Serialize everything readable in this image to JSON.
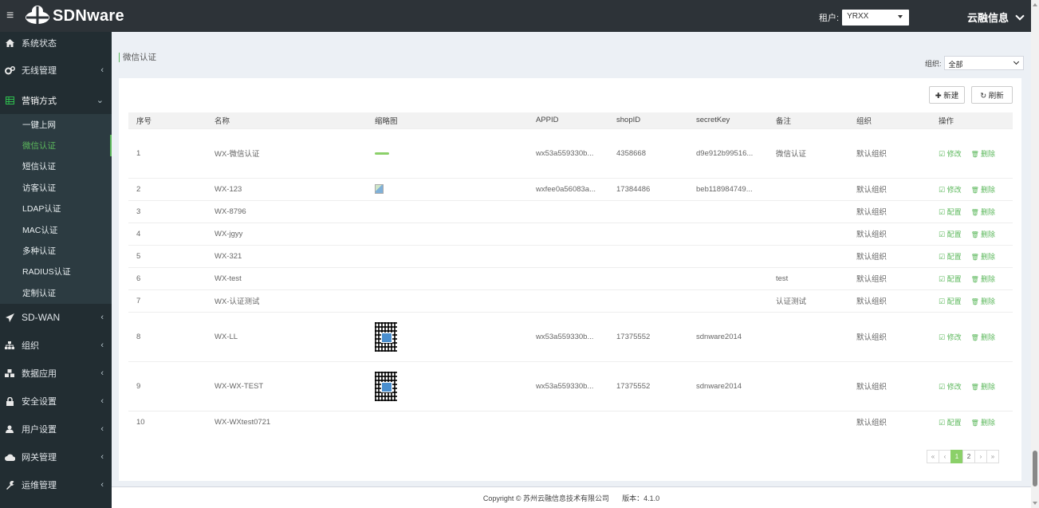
{
  "topbar": {
    "logo_text": "SDNware",
    "tenant_label": "租户:",
    "tenant_value": "YRXX",
    "brand": "云融信息"
  },
  "sidebar": {
    "items": [
      {
        "label": "系统状态",
        "icon": "home-icon"
      },
      {
        "label": "无线管理",
        "icon": "gears-icon"
      },
      {
        "label": "营销方式",
        "icon": "table-icon"
      }
    ],
    "sub_items": [
      "一键上网",
      "微信认证",
      "短信认证",
      "访客认证",
      "LDAP认证",
      "MAC认证",
      "多种认证",
      "RADIUS认证",
      "定制认证"
    ],
    "items_after": [
      {
        "label": "SD-WAN",
        "icon": "send-icon"
      },
      {
        "label": "组织",
        "icon": "sitemap-icon"
      },
      {
        "label": "数据应用",
        "icon": "cubes-icon"
      },
      {
        "label": "安全设置",
        "icon": "lock-icon"
      },
      {
        "label": "用户设置",
        "icon": "user-icon"
      },
      {
        "label": "网关管理",
        "icon": "cloud-icon"
      },
      {
        "label": "运维管理",
        "icon": "wrench-icon"
      }
    ]
  },
  "header": {
    "title": "微信认证",
    "org_label": "组织:",
    "org_value": "全部"
  },
  "toolbar": {
    "new_label": "✚ 新建",
    "refresh_label": "↻ 刷新"
  },
  "table": {
    "columns": [
      "序号",
      "名称",
      "缩略图",
      "APPID",
      "shopID",
      "secretKey",
      "备注",
      "组织",
      "操作"
    ],
    "rows": [
      {
        "no": "1",
        "name": "WX-微信认证",
        "thumb": "bar",
        "appid": "wx53a559330b...",
        "shopid": "4358668",
        "secret": "d9e912b99516...",
        "note": "微信认证",
        "org": "默认组织",
        "op1": "修改",
        "op2": "删除"
      },
      {
        "no": "2",
        "name": "WX-123",
        "thumb": "broken",
        "appid": "wxfee0a56083a...",
        "shopid": "17384486",
        "secret": "beb118984749...",
        "note": "",
        "org": "默认组织",
        "op1": "修改",
        "op2": "删除"
      },
      {
        "no": "3",
        "name": "WX-8796",
        "thumb": "",
        "appid": "",
        "shopid": "",
        "secret": "",
        "note": "",
        "org": "默认组织",
        "op1": "配置",
        "op2": "删除"
      },
      {
        "no": "4",
        "name": "WX-jgyy",
        "thumb": "",
        "appid": "",
        "shopid": "",
        "secret": "",
        "note": "",
        "org": "默认组织",
        "op1": "配置",
        "op2": "删除"
      },
      {
        "no": "5",
        "name": "WX-321",
        "thumb": "",
        "appid": "",
        "shopid": "",
        "secret": "",
        "note": "",
        "org": "默认组织",
        "op1": "配置",
        "op2": "删除"
      },
      {
        "no": "6",
        "name": "WX-test",
        "thumb": "",
        "appid": "",
        "shopid": "",
        "secret": "",
        "note": "test",
        "org": "默认组织",
        "op1": "配置",
        "op2": "删除"
      },
      {
        "no": "7",
        "name": "WX-认证测试",
        "thumb": "",
        "appid": "",
        "shopid": "",
        "secret": "",
        "note": "认证测试",
        "org": "默认组织",
        "op1": "配置",
        "op2": "删除"
      },
      {
        "no": "8",
        "name": "WX-LL",
        "thumb": "qr",
        "appid": "wx53a559330b...",
        "shopid": "17375552",
        "secret": "sdnware2014",
        "note": "",
        "org": "默认组织",
        "op1": "修改",
        "op2": "删除"
      },
      {
        "no": "9",
        "name": "WX-WX-TEST",
        "thumb": "qr",
        "appid": "wx53a559330b...",
        "shopid": "17375552",
        "secret": "sdnware2014",
        "note": "",
        "org": "默认组织",
        "op1": "修改",
        "op2": "删除"
      },
      {
        "no": "10",
        "name": "WX-WXtest0721",
        "thumb": "",
        "appid": "",
        "shopid": "",
        "secret": "",
        "note": "",
        "org": "默认组织",
        "op1": "配置",
        "op2": "删除"
      }
    ]
  },
  "pagination": {
    "first": "«",
    "prev": "‹",
    "pages": [
      "1",
      "2"
    ],
    "current": "1",
    "next": "›",
    "last": "»"
  },
  "footer": {
    "copyright": "Copyright © 苏州云融信息技术有限公司",
    "version": "版本：4.1.0"
  },
  "colors": {
    "accent": "#5cb85c",
    "topbar": "#2d3338",
    "sidebar": "#222d32"
  }
}
